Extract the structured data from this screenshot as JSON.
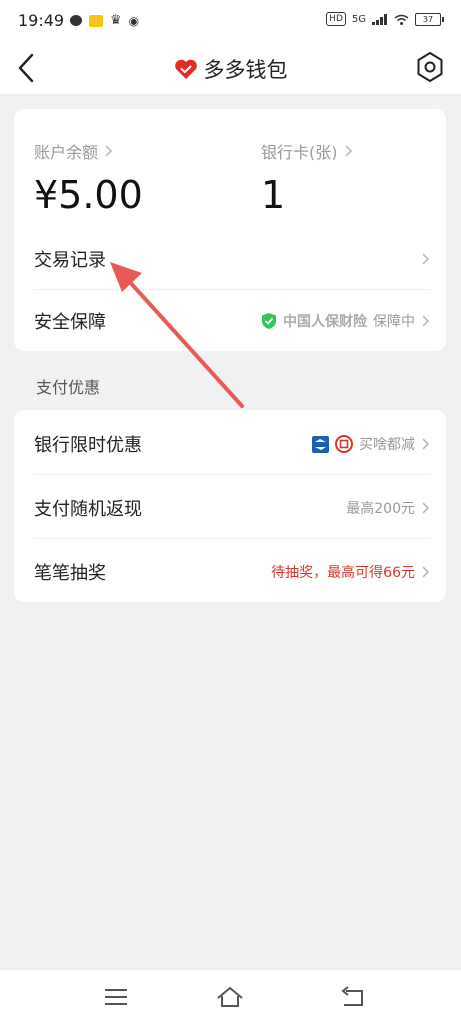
{
  "status": {
    "time": "19:49",
    "network": "5G",
    "battery": "37"
  },
  "header": {
    "title": "多多钱包",
    "back_label": "back",
    "settings_label": "settings"
  },
  "wallet": {
    "balance_label": "账户余额",
    "balance_value": "¥5.00",
    "bankcard_label": "银行卡(张)",
    "bankcard_value": "1"
  },
  "rows": {
    "transactions": "交易记录",
    "security": "安全保障",
    "security_brand": "中国人保财险",
    "security_status": "保障中"
  },
  "section_title": "支付优惠",
  "offers": {
    "bank_offer_label": "银行限时优惠",
    "bank_offer_value": "买啥都减",
    "cashback_label": "支付随机返现",
    "cashback_value": "最高200元",
    "lottery_label": "笔笔抽奖",
    "lottery_value": "待抽奖，最高可得66元"
  },
  "colors": {
    "accent": "#e02e24",
    "arrow": "#e85a55",
    "shield": "#2ec55c"
  },
  "icons": [
    "back-icon",
    "heart-wallet-icon",
    "gear-icon",
    "shield-check-icon",
    "bank-logo-icon",
    "icbc-logo-icon",
    "chevron-right-icon",
    "menu-icon",
    "home-icon",
    "return-icon"
  ]
}
